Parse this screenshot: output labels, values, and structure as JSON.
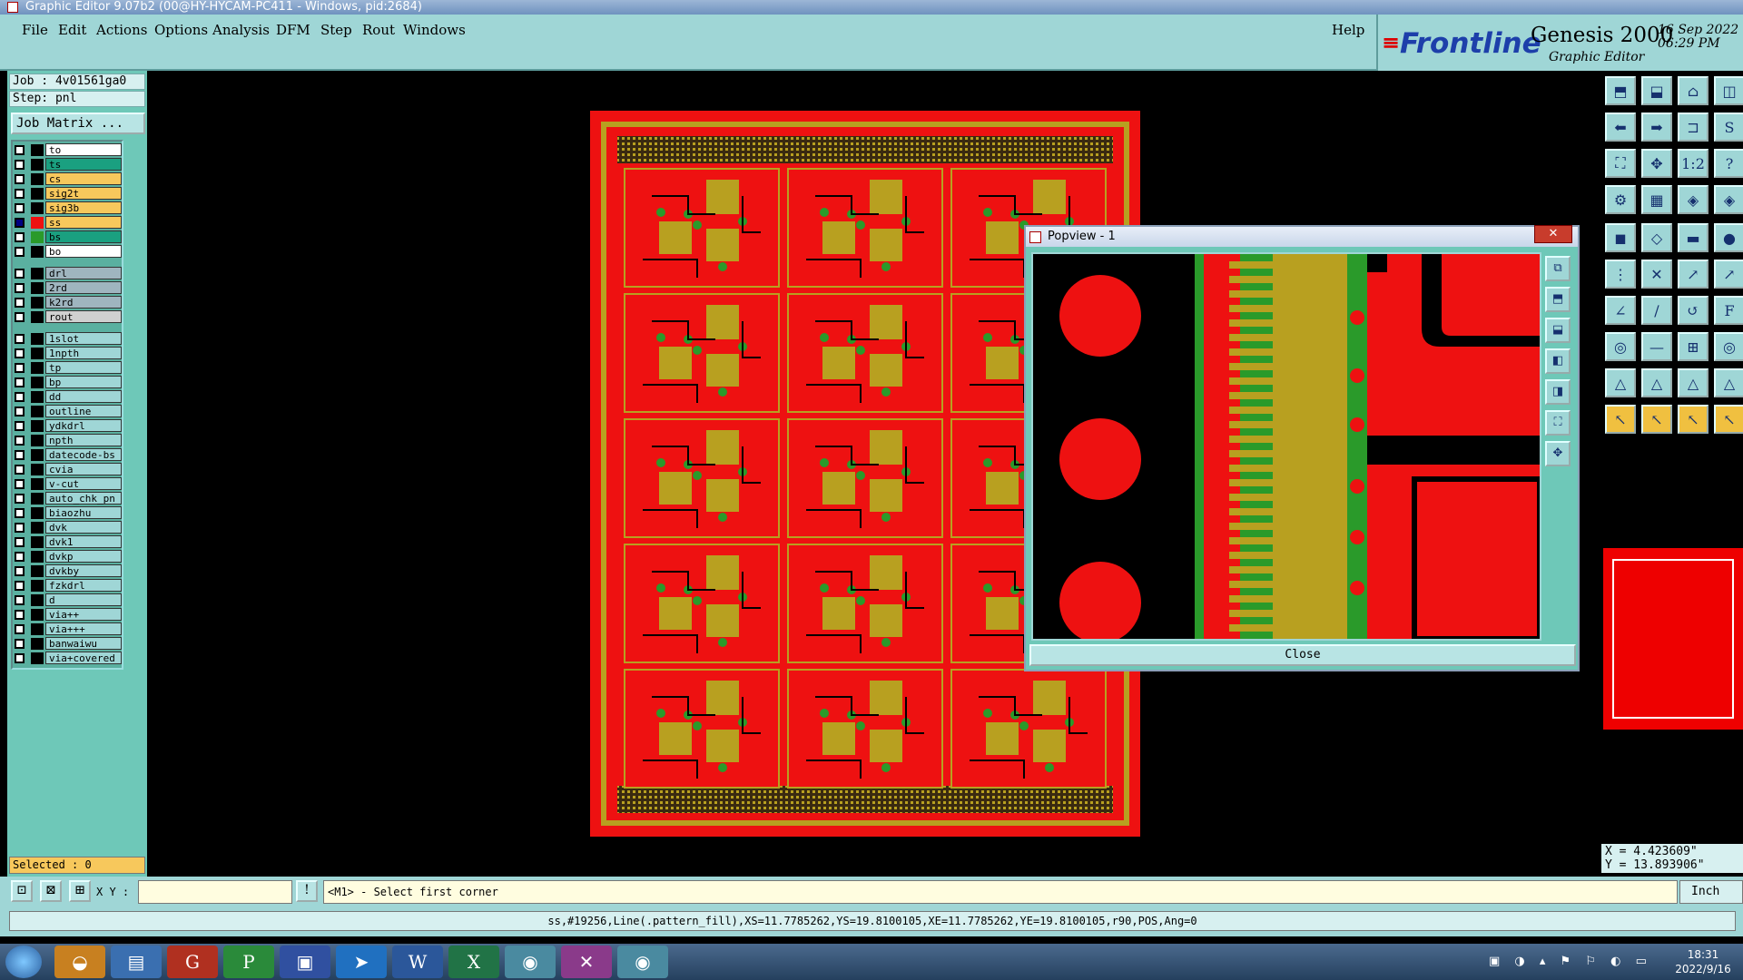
{
  "window": {
    "title": "Graphic Editor 9.07b2 (00@HY-HYCAM-PC411 - Windows, pid:2684)"
  },
  "menu": {
    "items": [
      "File",
      "Edit",
      "Actions",
      "Options",
      "Analysis",
      "DFM",
      "Step",
      "Rout",
      "Windows"
    ],
    "help": "Help"
  },
  "brand": {
    "logo": "Frontline",
    "product": "Genesis 2000",
    "subtitle": "Graphic Editor",
    "date": "16 Sep 2022",
    "time": "06:29 PM"
  },
  "job": {
    "job_label": "Job : 4v01561ga0",
    "step_label": "Step: pnl",
    "matrix_button": "Job Matrix ..."
  },
  "layers": [
    {
      "name": "to",
      "color": "#ffffff"
    },
    {
      "name": "ts",
      "color": "#1aa080"
    },
    {
      "name": "cs",
      "color": "#f7c85c"
    },
    {
      "name": "sig2t",
      "color": "#f7c85c"
    },
    {
      "name": "sig3b",
      "color": "#f7c85c"
    },
    {
      "name": "ss",
      "color": "#f7c85c",
      "swatch": "#ee1111",
      "active": true
    },
    {
      "name": "bs",
      "color": "#1aa080",
      "swatch": "#2a9a2a"
    },
    {
      "name": "bo",
      "color": "#ffffff"
    },
    {
      "name": "drl",
      "color": "#9fb5bf"
    },
    {
      "name": "2rd",
      "color": "#9fb5bf"
    },
    {
      "name": "k2rd",
      "color": "#9fb5bf"
    },
    {
      "name": "rout",
      "color": "#d0d0d0"
    },
    {
      "name": "1slot",
      "color": "#9fd6d6"
    },
    {
      "name": "1npth",
      "color": "#9fd6d6"
    },
    {
      "name": "tp",
      "color": "#9fd6d6"
    },
    {
      "name": "bp",
      "color": "#9fd6d6"
    },
    {
      "name": "dd",
      "color": "#9fd6d6"
    },
    {
      "name": "outline",
      "color": "#9fd6d6"
    },
    {
      "name": "ydkdrl",
      "color": "#9fd6d6"
    },
    {
      "name": "npth",
      "color": "#9fd6d6"
    },
    {
      "name": "datecode-bs",
      "color": "#9fd6d6"
    },
    {
      "name": "cvia",
      "color": "#9fd6d6"
    },
    {
      "name": "v-cut",
      "color": "#9fd6d6"
    },
    {
      "name": "auto_chk_pn",
      "color": "#9fd6d6"
    },
    {
      "name": "biaozhu",
      "color": "#9fd6d6"
    },
    {
      "name": "dvk",
      "color": "#9fd6d6"
    },
    {
      "name": "dvk1",
      "color": "#9fd6d6"
    },
    {
      "name": "dvkp",
      "color": "#9fd6d6"
    },
    {
      "name": "dvkby",
      "color": "#9fd6d6"
    },
    {
      "name": "fzkdrl",
      "color": "#9fd6d6"
    },
    {
      "name": "d",
      "color": "#9fd6d6"
    },
    {
      "name": "via++",
      "color": "#9fd6d6"
    },
    {
      "name": "via+++",
      "color": "#9fd6d6"
    },
    {
      "name": "banwaiwu",
      "color": "#9fd6d6"
    },
    {
      "name": "via+covered",
      "color": "#9fd6d6"
    }
  ],
  "selected": "Selected : 0",
  "popview": {
    "title": "Popview - 1",
    "close_label": "Close"
  },
  "coords": {
    "x": "X = 4.423609\"",
    "y": "Y = 13.893906\""
  },
  "command": {
    "xy_label": "X Y :",
    "xy_value": "",
    "prompt": "<M1> - Select first corner",
    "units": "Inch"
  },
  "status": "ss,#19256,Line(.pattern_fill),XS=11.7785262,YS=19.8100105,XE=11.7785262,YE=19.8100105,r90,POS,Ang=0",
  "taskbar": {
    "time": "18:31",
    "date": "2022/9/16"
  },
  "colors": {
    "board": "#ee1111",
    "copper_gold": "#b8a020",
    "mask_green": "#2a9a2a",
    "panel_bg": "#9fd6d6"
  }
}
